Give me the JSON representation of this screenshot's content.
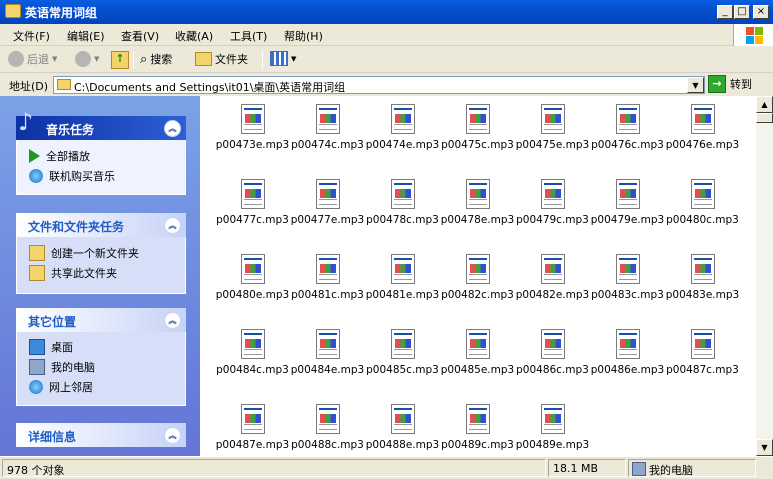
{
  "window": {
    "title": "英语常用词组",
    "min": "_",
    "max": "□",
    "close": "×"
  },
  "menu": [
    "文件(F)",
    "编辑(E)",
    "查看(V)",
    "收藏(A)",
    "工具(T)",
    "帮助(H)"
  ],
  "toolbar": {
    "back": "后退",
    "search": "搜索",
    "folders": "文件夹"
  },
  "address": {
    "label": "地址(D)",
    "path": "C:\\Documents and Settings\\it01\\桌面\\英语常用词组",
    "go": "转到"
  },
  "panels": {
    "music": {
      "title": "音乐任务",
      "items": [
        "全部播放",
        "联机购买音乐"
      ]
    },
    "file_tasks": {
      "title": "文件和文件夹任务",
      "items": [
        "创建一个新文件夹",
        "共享此文件夹"
      ]
    },
    "other_places": {
      "title": "其它位置",
      "items": [
        "桌面",
        "我的电脑",
        "网上邻居"
      ]
    },
    "details": {
      "title": "详细信息"
    }
  },
  "files": [
    "p00473e.mp3",
    "p00474c.mp3",
    "p00474e.mp3",
    "p00475c.mp3",
    "p00475e.mp3",
    "p00476c.mp3",
    "p00476e.mp3",
    "p00477c.mp3",
    "p00477e.mp3",
    "p00478c.mp3",
    "p00478e.mp3",
    "p00479c.mp3",
    "p00479e.mp3",
    "p00480c.mp3",
    "p00480e.mp3",
    "p00481c.mp3",
    "p00481e.mp3",
    "p00482c.mp3",
    "p00482e.mp3",
    "p00483c.mp3",
    "p00483e.mp3",
    "p00484c.mp3",
    "p00484e.mp3",
    "p00485c.mp3",
    "p00485e.mp3",
    "p00486c.mp3",
    "p00486e.mp3",
    "p00487c.mp3",
    "p00487e.mp3",
    "p00488c.mp3",
    "p00488e.mp3",
    "p00489c.mp3",
    "p00489e.mp3"
  ],
  "status": {
    "count": "978 个对象",
    "size": "18.1 MB",
    "location": "我的电脑"
  },
  "colors": {
    "title_bar": "#0450d0",
    "task_pane": "#6f8fe0",
    "panel_header": "#ffffff",
    "panel_text": "#215dc6"
  }
}
